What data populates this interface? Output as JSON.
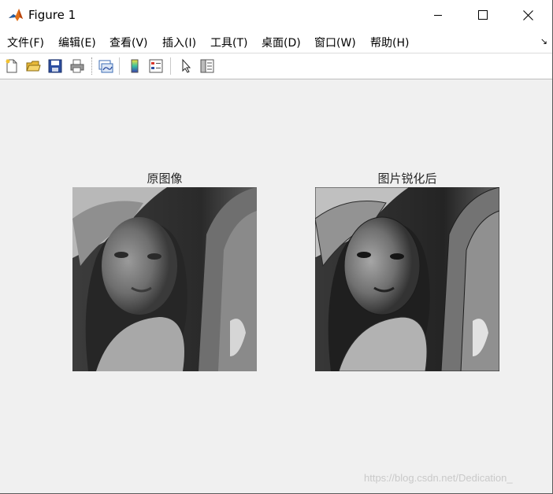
{
  "window": {
    "title": "Figure 1",
    "controls": {
      "minimize": "minimize-icon",
      "maximize": "maximize-icon",
      "close": "close-icon"
    }
  },
  "menubar": {
    "items": [
      {
        "label": "文件(F)",
        "key": "F"
      },
      {
        "label": "编辑(E)",
        "key": "E"
      },
      {
        "label": "查看(V)",
        "key": "V"
      },
      {
        "label": "插入(I)",
        "key": "I"
      },
      {
        "label": "工具(T)",
        "key": "T"
      },
      {
        "label": "桌面(D)",
        "key": "D"
      },
      {
        "label": "窗口(W)",
        "key": "W"
      },
      {
        "label": "帮助(H)",
        "key": "H"
      }
    ],
    "dock_glyph": "↘"
  },
  "toolbar": {
    "buttons": [
      {
        "icon": "new-figure-icon"
      },
      {
        "icon": "open-file-icon"
      },
      {
        "icon": "save-icon"
      },
      {
        "icon": "print-icon"
      },
      {
        "icon": "link-plot-icon"
      },
      {
        "icon": "insert-colorbar-icon"
      },
      {
        "icon": "insert-legend-icon"
      },
      {
        "icon": "edit-plot-arrow-icon"
      },
      {
        "icon": "show-plot-tools-icon"
      }
    ]
  },
  "axes": [
    {
      "title": "原图像",
      "image": "original-grayscale-portrait"
    },
    {
      "title": "图片锐化后",
      "image": "sharpened-grayscale-portrait"
    }
  ],
  "watermark": "https://blog.csdn.net/Dedication_",
  "colors": {
    "window_bg": "#f0f0f0",
    "chrome_bg": "#ffffff",
    "title_text": "#262626",
    "watermark": "#c9c9c9"
  }
}
